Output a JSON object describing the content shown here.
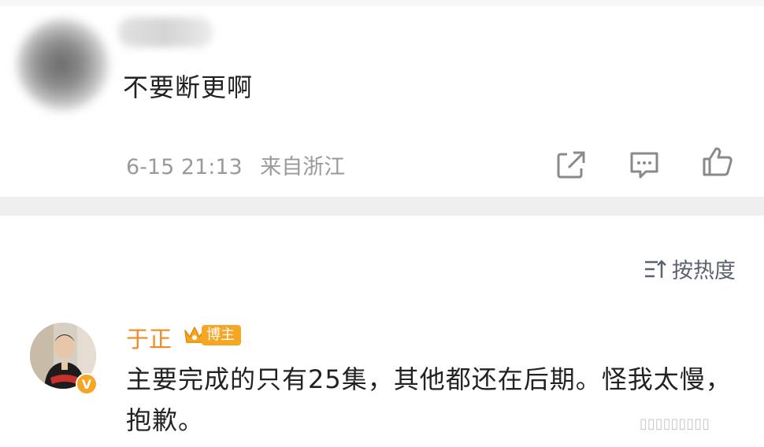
{
  "comment": {
    "text": "不要断更啊",
    "time": "6-15 21:13",
    "location": "来自浙江",
    "icons": [
      "share-icon",
      "comment-icon",
      "thumbs-up-icon"
    ]
  },
  "sort": {
    "label": "按热度",
    "icon": "sort-icon"
  },
  "reply": {
    "author": "于正",
    "badge": "博主",
    "verified_mark": "V",
    "text": "主要完成的只有25集，其他都还在后期。怪我太慢，抱歉。"
  },
  "colors": {
    "author_name": "#f08a24",
    "badge_bg": "#f5a623",
    "meta_text": "#9a9a9a",
    "separator": "#efefef"
  }
}
